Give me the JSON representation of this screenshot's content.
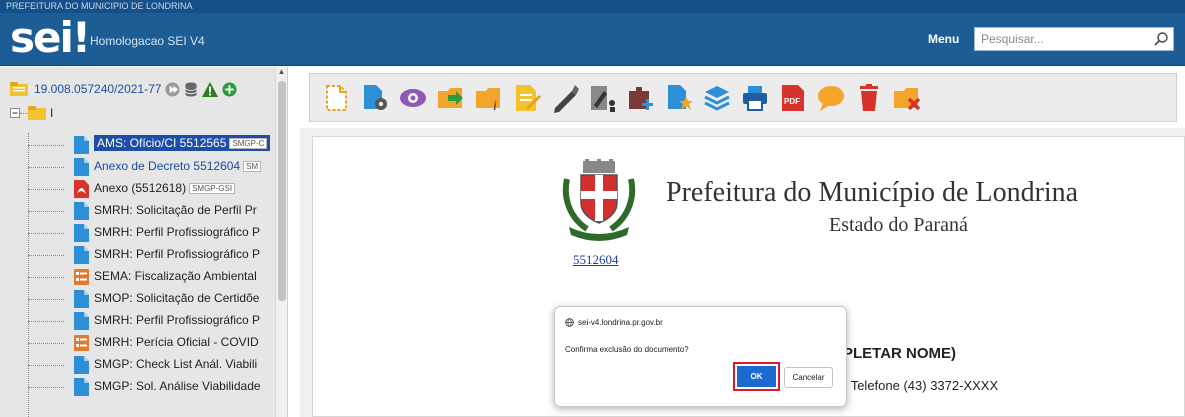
{
  "top_banner": "PREFEITURA DO MUNICIPIO DE LONDRINA",
  "header": {
    "logo_text": "sei",
    "environment": "Homologacao SEI V4",
    "menu_label": "Menu",
    "search_placeholder": "Pesquisar..."
  },
  "tree": {
    "process_number": "19.008.057240/2021-77",
    "folder_label": "I",
    "documents": [
      {
        "label": "AMS: Ofício/CI 5512565",
        "badge": "SMGP-C",
        "icon": "document-icon",
        "state": "selected"
      },
      {
        "label": "Anexo de Decreto 5512604",
        "badge": "SM",
        "icon": "document-icon",
        "state": "current"
      },
      {
        "label": "Anexo (5512618)",
        "badge": "SMGP-GSI",
        "icon": "pdf-icon",
        "state": "normal"
      },
      {
        "label": "SMRH: Solicitação de Perfil Pr",
        "badge": "",
        "icon": "document-icon",
        "state": "normal"
      },
      {
        "label": "SMRH: Perfil Profissiográfico P",
        "badge": "",
        "icon": "document-icon",
        "state": "normal"
      },
      {
        "label": "SMRH: Perfil Profissiográfico P",
        "badge": "",
        "icon": "document-icon",
        "state": "normal"
      },
      {
        "label": "SEMA: Fiscalização Ambiental",
        "badge": "",
        "icon": "form-icon",
        "state": "normal"
      },
      {
        "label": "SMOP: Solicitação de Certidõe",
        "badge": "",
        "icon": "document-icon",
        "state": "normal"
      },
      {
        "label": "SMRH: Perfil Profissiográfico P",
        "badge": "",
        "icon": "document-icon",
        "state": "normal"
      },
      {
        "label": "SMRH: Perícia Oficial - COVID",
        "badge": "",
        "icon": "form-icon",
        "state": "normal"
      },
      {
        "label": "SMGP: Check List Anál. Viabili",
        "badge": "",
        "icon": "document-icon",
        "state": "normal"
      },
      {
        "label": "SMGP: Sol. Análise Viabilidade",
        "badge": "",
        "icon": "document-icon",
        "state": "normal"
      }
    ]
  },
  "toolbar_icons": [
    "new-document-icon",
    "document-settings-icon",
    "view-icon",
    "move-document-icon",
    "document-info-icon",
    "edit-document-icon",
    "sign-icon",
    "signature-block-icon",
    "add-block-icon",
    "favorite-document-icon",
    "layers-icon",
    "print-icon",
    "pdf-export-icon",
    "comment-icon",
    "delete-icon",
    "cancel-document-icon"
  ],
  "document": {
    "org_title": "Prefeitura do Município de Londrina",
    "org_subtitle": "Estado do Paraná",
    "doc_link": "5512604",
    "body_line1": "PLETAR NOME)",
    "body_line2": "- Telefone (43) 3372-XXXX"
  },
  "dialog": {
    "origin": "sei-v4.londrina.pr.gov.br",
    "message": "Confirma exclusão do documento?",
    "ok_label": "OK",
    "cancel_label": "Cancelar"
  },
  "colors": {
    "header_bg": "#1c5d96",
    "selection": "#1e4fa8",
    "ok_button": "#1b6ad1",
    "highlight_frame": "#e0182e"
  }
}
